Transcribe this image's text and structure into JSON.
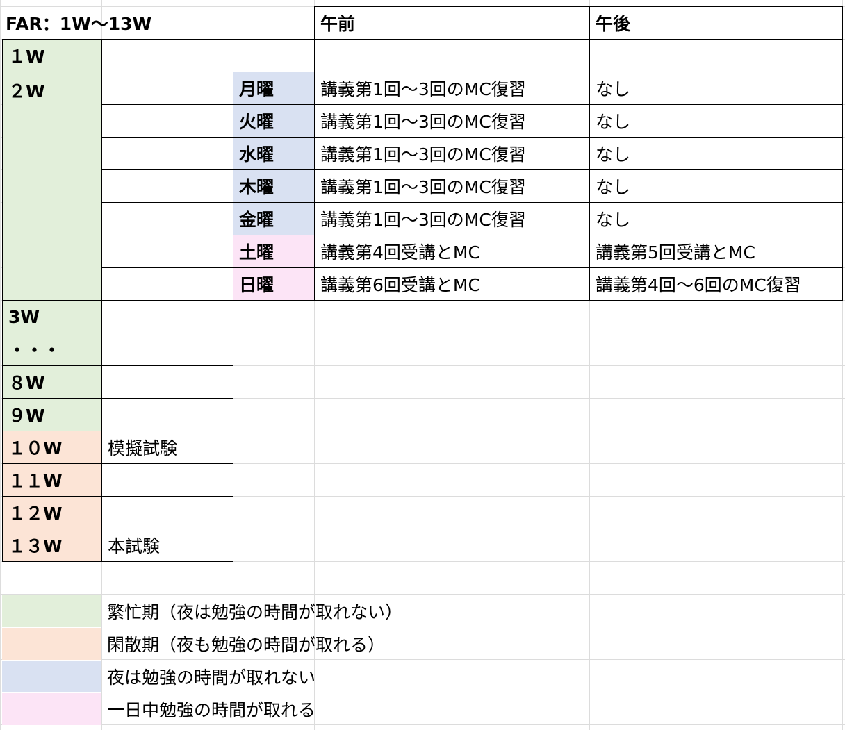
{
  "title": "FAR：1W～13W",
  "headers": {
    "am": "午前",
    "pm": "午後"
  },
  "colors": {
    "busy_green": "#e2efda",
    "free_orange": "#fce4d6",
    "weekday_blue": "#d9e1f2",
    "weekend_pink": "#fce4f6"
  },
  "weeks": [
    {
      "label": "１W",
      "note": ""
    },
    {
      "label": "２W",
      "note": ""
    },
    {
      "label": "3W",
      "note": ""
    },
    {
      "label": "・・・",
      "note": ""
    },
    {
      "label": "８W",
      "note": ""
    },
    {
      "label": "９W",
      "note": ""
    },
    {
      "label": "１０W",
      "note": "模擬試験"
    },
    {
      "label": "１１W",
      "note": ""
    },
    {
      "label": "１２W",
      "note": ""
    },
    {
      "label": "１３W",
      "note": "本試験"
    }
  ],
  "days": [
    {
      "day": "月曜",
      "am": "講義第1回～3回のMC復習",
      "pm": "なし"
    },
    {
      "day": "火曜",
      "am": "講義第1回～3回のMC復習",
      "pm": "なし"
    },
    {
      "day": "水曜",
      "am": "講義第1回～3回のMC復習",
      "pm": "なし"
    },
    {
      "day": "木曜",
      "am": "講義第1回～3回のMC復習",
      "pm": "なし"
    },
    {
      "day": "金曜",
      "am": "講義第1回～3回のMC復習",
      "pm": "なし"
    },
    {
      "day": "土曜",
      "am": "講義第4回受講とMC",
      "pm": "講義第5回受講とMC"
    },
    {
      "day": "日曜",
      "am": "講義第6回受講とMC",
      "pm": "講義第4回～6回のMC復習"
    }
  ],
  "legend": [
    "繁忙期（夜は勉強の時間が取れない）",
    "閑散期（夜も勉強の時間が取れる）",
    "夜は勉強の時間が取れない",
    "一日中勉強の時間が取れる"
  ]
}
